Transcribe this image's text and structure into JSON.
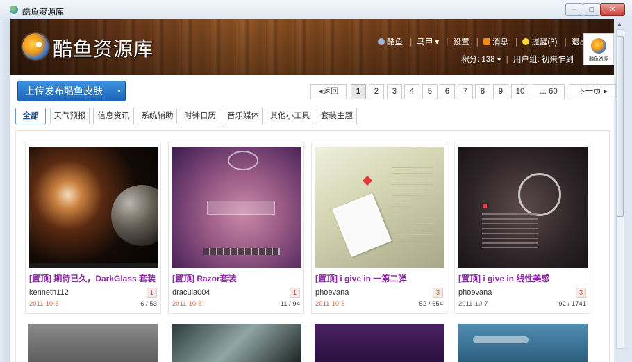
{
  "window": {
    "title": "酷鱼资源库",
    "min_label": "–",
    "max_label": "□",
    "close_label": "✕"
  },
  "header": {
    "logo_text": "酷鱼资源库",
    "user_name": "酷鱼",
    "character": "马甲",
    "settings": "设置",
    "messages": "消息",
    "reminders": "提醒(3)",
    "logout": "退出",
    "points": "积分: 138",
    "user_group": "用户组: 初来乍到",
    "avatar_caption": "酷鱼资源"
  },
  "toolbar": {
    "upload_label": "上传发布酷鱼皮肤"
  },
  "pagination": {
    "prev": "返回",
    "pages": [
      "1",
      "2",
      "3",
      "4",
      "5",
      "6",
      "7",
      "8",
      "9",
      "10",
      "... 60"
    ],
    "current": "1",
    "next": "下一页"
  },
  "categories": [
    "全部",
    "天气预报",
    "信息资讯",
    "系统辅助",
    "时钟日历",
    "音乐媒体",
    "其他小工具",
    "套装主题"
  ],
  "active_category": "全部",
  "items": [
    {
      "title": "[置顶] 期待已久，DarkGlass 套装",
      "author": "kenneth112",
      "badge": "1",
      "date": "2011-10-8",
      "stats": "6 / 53"
    },
    {
      "title": "[置顶] Razor套装",
      "author": "dracula004",
      "badge": "1",
      "date": "2011-10-8",
      "stats": "11 / 94"
    },
    {
      "title": "[置顶] i give in 一第二弹",
      "author": "phoevana",
      "badge": "3",
      "date": "2011-10-8",
      "stats": "52 / 654"
    },
    {
      "title": "[置顶] i give in 线性美感",
      "author": "phoevana",
      "badge": "3",
      "date": "2011-10-7",
      "stats": "92 / 1741"
    }
  ],
  "colors": {
    "accent_blue": "#1d65b8",
    "title_purple": "#8e2aa6",
    "date_orange": "#e06a4a"
  }
}
